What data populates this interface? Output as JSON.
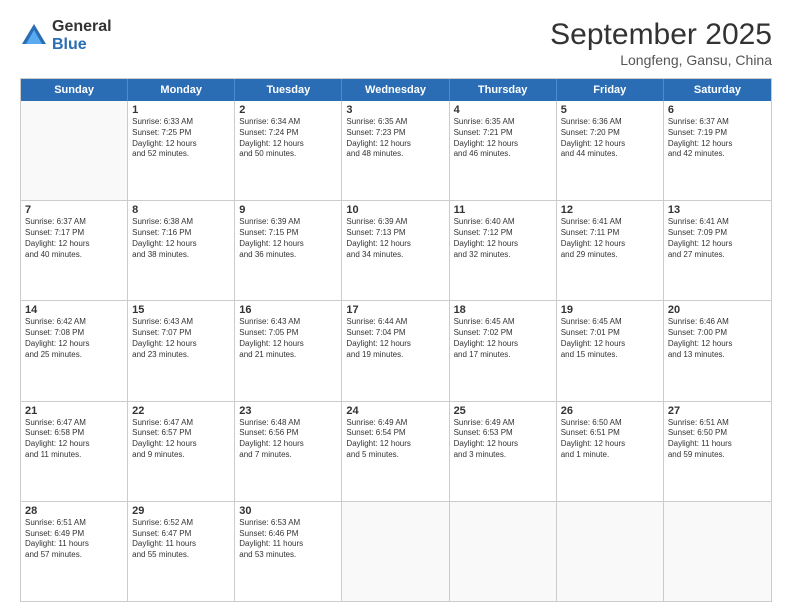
{
  "logo": {
    "general": "General",
    "blue": "Blue"
  },
  "title": "September 2025",
  "location": "Longfeng, Gansu, China",
  "days": [
    "Sunday",
    "Monday",
    "Tuesday",
    "Wednesday",
    "Thursday",
    "Friday",
    "Saturday"
  ],
  "rows": [
    [
      {
        "day": "",
        "text": ""
      },
      {
        "day": "1",
        "text": "Sunrise: 6:33 AM\nSunset: 7:25 PM\nDaylight: 12 hours\nand 52 minutes."
      },
      {
        "day": "2",
        "text": "Sunrise: 6:34 AM\nSunset: 7:24 PM\nDaylight: 12 hours\nand 50 minutes."
      },
      {
        "day": "3",
        "text": "Sunrise: 6:35 AM\nSunset: 7:23 PM\nDaylight: 12 hours\nand 48 minutes."
      },
      {
        "day": "4",
        "text": "Sunrise: 6:35 AM\nSunset: 7:21 PM\nDaylight: 12 hours\nand 46 minutes."
      },
      {
        "day": "5",
        "text": "Sunrise: 6:36 AM\nSunset: 7:20 PM\nDaylight: 12 hours\nand 44 minutes."
      },
      {
        "day": "6",
        "text": "Sunrise: 6:37 AM\nSunset: 7:19 PM\nDaylight: 12 hours\nand 42 minutes."
      }
    ],
    [
      {
        "day": "7",
        "text": "Sunrise: 6:37 AM\nSunset: 7:17 PM\nDaylight: 12 hours\nand 40 minutes."
      },
      {
        "day": "8",
        "text": "Sunrise: 6:38 AM\nSunset: 7:16 PM\nDaylight: 12 hours\nand 38 minutes."
      },
      {
        "day": "9",
        "text": "Sunrise: 6:39 AM\nSunset: 7:15 PM\nDaylight: 12 hours\nand 36 minutes."
      },
      {
        "day": "10",
        "text": "Sunrise: 6:39 AM\nSunset: 7:13 PM\nDaylight: 12 hours\nand 34 minutes."
      },
      {
        "day": "11",
        "text": "Sunrise: 6:40 AM\nSunset: 7:12 PM\nDaylight: 12 hours\nand 32 minutes."
      },
      {
        "day": "12",
        "text": "Sunrise: 6:41 AM\nSunset: 7:11 PM\nDaylight: 12 hours\nand 29 minutes."
      },
      {
        "day": "13",
        "text": "Sunrise: 6:41 AM\nSunset: 7:09 PM\nDaylight: 12 hours\nand 27 minutes."
      }
    ],
    [
      {
        "day": "14",
        "text": "Sunrise: 6:42 AM\nSunset: 7:08 PM\nDaylight: 12 hours\nand 25 minutes."
      },
      {
        "day": "15",
        "text": "Sunrise: 6:43 AM\nSunset: 7:07 PM\nDaylight: 12 hours\nand 23 minutes."
      },
      {
        "day": "16",
        "text": "Sunrise: 6:43 AM\nSunset: 7:05 PM\nDaylight: 12 hours\nand 21 minutes."
      },
      {
        "day": "17",
        "text": "Sunrise: 6:44 AM\nSunset: 7:04 PM\nDaylight: 12 hours\nand 19 minutes."
      },
      {
        "day": "18",
        "text": "Sunrise: 6:45 AM\nSunset: 7:02 PM\nDaylight: 12 hours\nand 17 minutes."
      },
      {
        "day": "19",
        "text": "Sunrise: 6:45 AM\nSunset: 7:01 PM\nDaylight: 12 hours\nand 15 minutes."
      },
      {
        "day": "20",
        "text": "Sunrise: 6:46 AM\nSunset: 7:00 PM\nDaylight: 12 hours\nand 13 minutes."
      }
    ],
    [
      {
        "day": "21",
        "text": "Sunrise: 6:47 AM\nSunset: 6:58 PM\nDaylight: 12 hours\nand 11 minutes."
      },
      {
        "day": "22",
        "text": "Sunrise: 6:47 AM\nSunset: 6:57 PM\nDaylight: 12 hours\nand 9 minutes."
      },
      {
        "day": "23",
        "text": "Sunrise: 6:48 AM\nSunset: 6:56 PM\nDaylight: 12 hours\nand 7 minutes."
      },
      {
        "day": "24",
        "text": "Sunrise: 6:49 AM\nSunset: 6:54 PM\nDaylight: 12 hours\nand 5 minutes."
      },
      {
        "day": "25",
        "text": "Sunrise: 6:49 AM\nSunset: 6:53 PM\nDaylight: 12 hours\nand 3 minutes."
      },
      {
        "day": "26",
        "text": "Sunrise: 6:50 AM\nSunset: 6:51 PM\nDaylight: 12 hours\nand 1 minute."
      },
      {
        "day": "27",
        "text": "Sunrise: 6:51 AM\nSunset: 6:50 PM\nDaylight: 11 hours\nand 59 minutes."
      }
    ],
    [
      {
        "day": "28",
        "text": "Sunrise: 6:51 AM\nSunset: 6:49 PM\nDaylight: 11 hours\nand 57 minutes."
      },
      {
        "day": "29",
        "text": "Sunrise: 6:52 AM\nSunset: 6:47 PM\nDaylight: 11 hours\nand 55 minutes."
      },
      {
        "day": "30",
        "text": "Sunrise: 6:53 AM\nSunset: 6:46 PM\nDaylight: 11 hours\nand 53 minutes."
      },
      {
        "day": "",
        "text": ""
      },
      {
        "day": "",
        "text": ""
      },
      {
        "day": "",
        "text": ""
      },
      {
        "day": "",
        "text": ""
      }
    ]
  ]
}
